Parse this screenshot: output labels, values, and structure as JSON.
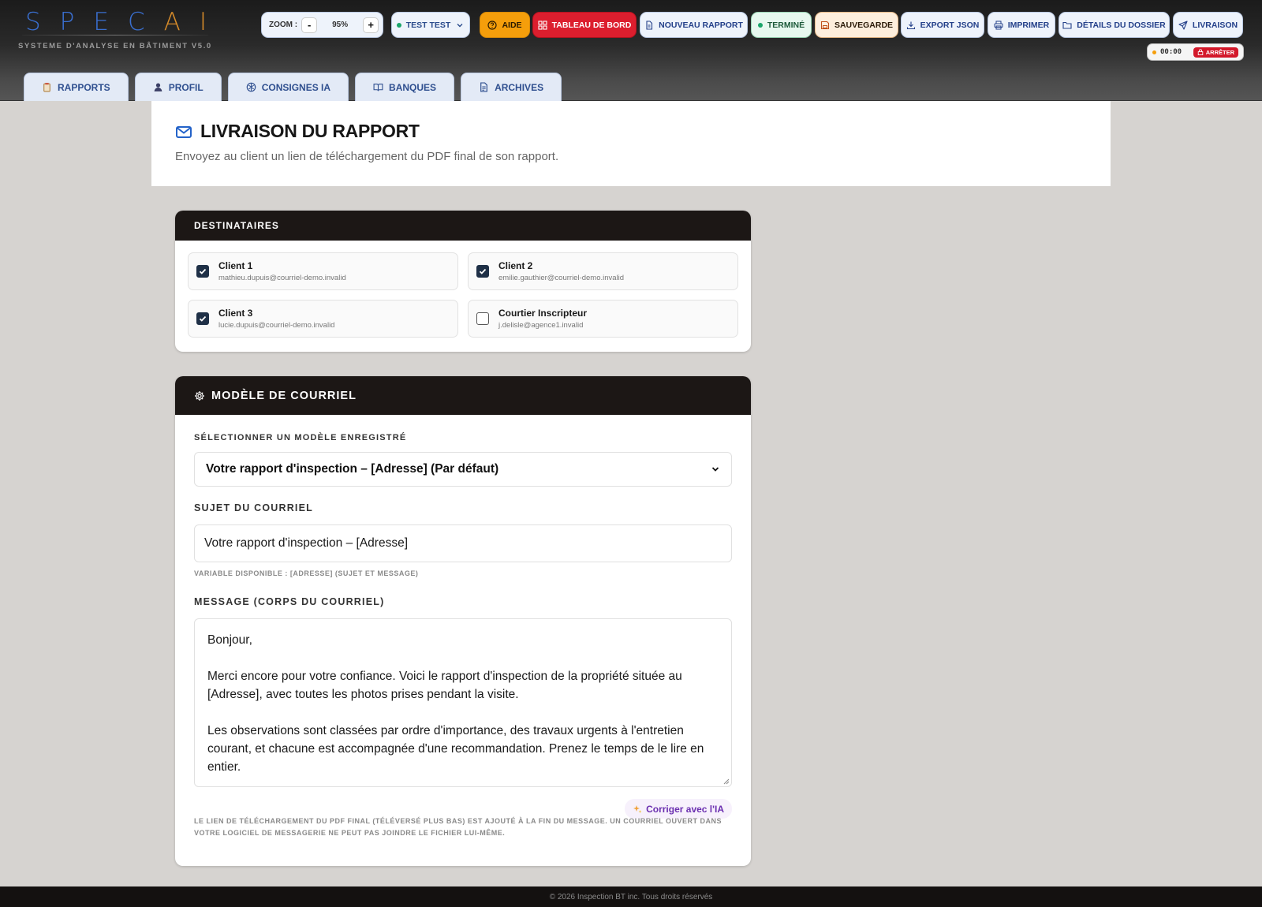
{
  "app": {
    "logo_main": "SPEC",
    "logo_accent": "AI",
    "subtitle": "SYSTEME D'ANALYSE EN BÂTIMENT V5.0"
  },
  "toolbar": {
    "zoom_label": "ZOOM :",
    "zoom_minus": "-",
    "zoom_value": "95%",
    "zoom_plus": "+",
    "user": "TEST TEST",
    "help": "AIDE",
    "dashboard": "TABLEAU DE BORD",
    "new_report": "NOUVEAU RAPPORT",
    "status": "TERMINÉ",
    "save": "SAUVEGARDE",
    "export_json": "EXPORT JSON",
    "print": "IMPRIMER",
    "folder_details": "DÉTAILS DU DOSSIER",
    "delivery": "LIVRAISON",
    "timer": "00:00",
    "stop": "ARRÊTER"
  },
  "tabs": [
    "RAPPORTS",
    "PROFIL",
    "CONSIGNES IA",
    "BANQUES",
    "ARCHIVES"
  ],
  "page": {
    "title": "LIVRAISON DU RAPPORT",
    "subtitle": "Envoyez au client un lien de téléchargement du PDF final de son rapport."
  },
  "recipients": {
    "title": "DESTINATAIRES",
    "items": [
      {
        "name": "Client 1",
        "email": "mathieu.dupuis@courriel-demo.invalid",
        "checked": true
      },
      {
        "name": "Client 2",
        "email": "emilie.gauthier@courriel-demo.invalid",
        "checked": true
      },
      {
        "name": "Client 3",
        "email": "lucie.dupuis@courriel-demo.invalid",
        "checked": true
      },
      {
        "name": "Courtier Inscripteur",
        "email": "j.delisle@agence1.invalid",
        "checked": false
      }
    ]
  },
  "template": {
    "title": "MODÈLE DE COURRIEL",
    "select_label": "SÉLECTIONNER UN MODÈLE ENREGISTRÉ",
    "selected": "Votre rapport d'inspection – [Adresse] (Par défaut)",
    "subject_label": "SUJET DU COURRIEL",
    "subject": "Votre rapport d'inspection – [Adresse]",
    "variable_hint": "VARIABLE DISPONIBLE : [ADRESSE] (SUJET ET MESSAGE)",
    "message_label": "MESSAGE (CORPS DU COURRIEL)",
    "message": [
      "Bonjour,",
      "Merci encore pour votre confiance. Voici le rapport d'inspection de la propriété située au [Adresse], avec toutes les photos prises pendant la visite.",
      "Les observations sont classées par ordre d'importance, des travaux urgents à l'entretien courant, et chacune est accompagnée d'une recommandation. Prenez le temps de le lire en entier."
    ],
    "ai_fix": "Corriger avec l'IA",
    "footer_note": "LE LIEN DE TÉLÉCHARGEMENT DU PDF FINAL (TÉLÉVERSÉ PLUS BAS) EST AJOUTÉ À LA FIN DU MESSAGE. UN COURRIEL OUVERT DANS VOTRE LOGICIEL DE MESSAGERIE NE PEUT PAS JOINDRE LE FICHIER LUI-MÊME."
  },
  "footer": "© 2026 Inspection BT inc. Tous droits réservés",
  "colors": {
    "accent_blue": "#2f4f8f",
    "danger": "#dc1e2e",
    "warning": "#f59e0b",
    "success": "#1aa56a",
    "dark_header": "#1c1715"
  }
}
